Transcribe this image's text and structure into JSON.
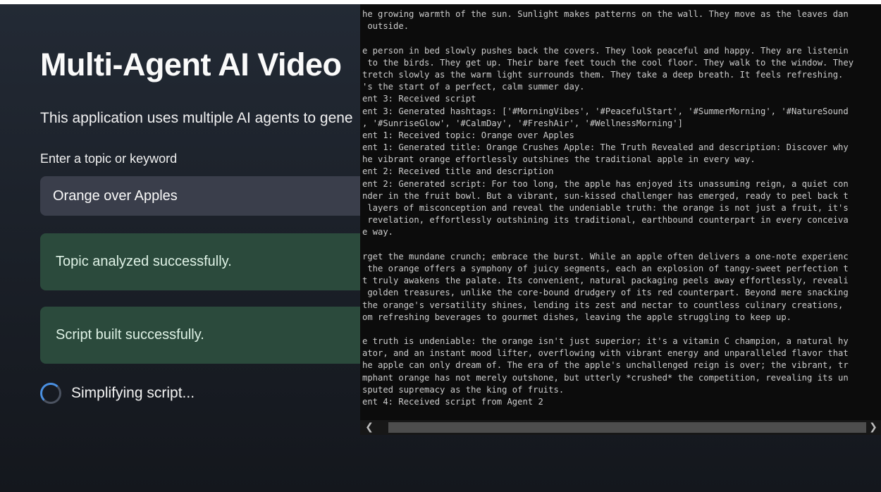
{
  "app": {
    "title": "Multi-Agent AI Video",
    "description": "This application uses multiple AI agents to gene",
    "input_label": "Enter a topic or keyword",
    "topic_value": "Orange over Apples",
    "alerts": [
      "Topic analyzed successfully.",
      "Script built successfully."
    ],
    "spinner_text": "Simplifying script..."
  },
  "console": {
    "lines": [
      "he growing warmth of the sun. Sunlight makes patterns on the wall. They move as the leaves dan",
      " outside.",
      "",
      "e person in bed slowly pushes back the covers. They look peaceful and happy. They are listenin",
      " to the birds. They get up. Their bare feet touch the cool floor. They walk to the window. They",
      "tretch slowly as the warm light surrounds them. They take a deep breath. It feels refreshing.",
      "'s the start of a perfect, calm summer day.",
      "ent 3: Received script",
      "ent 3: Generated hashtags: ['#MorningVibes', '#PeacefulStart', '#SummerMorning', '#NatureSound",
      ", '#SunriseGlow', '#CalmDay', '#FreshAir', '#WellnessMorning']",
      "ent 1: Received topic: Orange over Apples",
      "ent 1: Generated title: Orange Crushes Apple: The Truth Revealed and description: Discover why",
      "he vibrant orange effortlessly outshines the traditional apple in every way.",
      "ent 2: Received title and description",
      "ent 2: Generated script: For too long, the apple has enjoyed its unassuming reign, a quiet con",
      "nder in the fruit bowl. But a vibrant, sun-kissed challenger has emerged, ready to peel back t",
      " layers of misconception and reveal the undeniable truth: the orange is not just a fruit, it's",
      " revelation, effortlessly outshining its traditional, earthbound counterpart in every conceiva",
      "e way.",
      "",
      "rget the mundane crunch; embrace the burst. While an apple often delivers a one-note experienc",
      " the orange offers a symphony of juicy segments, each an explosion of tangy-sweet perfection t",
      "t truly awakens the palate. Its convenient, natural packaging peels away effortlessly, reveali",
      " golden treasures, unlike the core-bound drudgery of its red counterpart. Beyond mere snacking",
      "the orange's versatility shines, lending its zest and nectar to countless culinary creations,",
      "om refreshing beverages to gourmet dishes, leaving the apple struggling to keep up.",
      "",
      "e truth is undeniable: the orange isn't just superior; it's a vitamin C champion, a natural hy",
      "ator, and an instant mood lifter, overflowing with vibrant energy and unparalleled flavor that",
      "he apple can only dream of. The era of the apple's unchallenged reign is over; the vibrant, tr",
      "mphant orange has not merely outshone, but utterly *crushed* the competition, revealing its un",
      "sputed supremacy as the king of fruits.",
      "ent 4: Received script from Agent 2"
    ],
    "scroll_left_icon": "chevron-left-icon",
    "scroll_right_icon": "chevron-right-icon"
  }
}
